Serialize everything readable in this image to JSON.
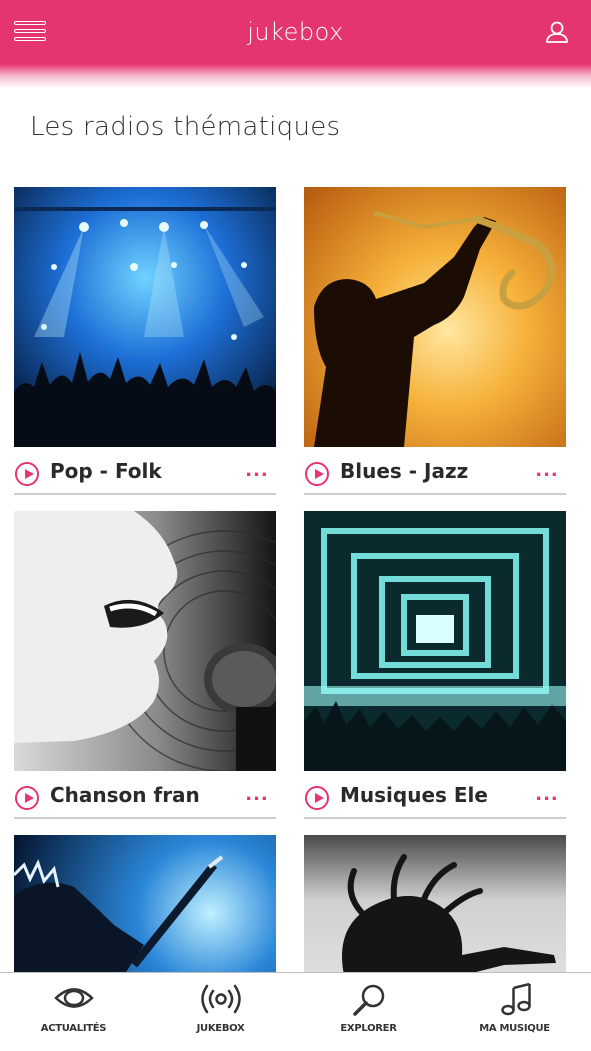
{
  "header": {
    "title": "jukebox",
    "menu_icon": "hamburger-menu-icon",
    "user_icon": "user-icon"
  },
  "section": {
    "title": "Les radios thématiques"
  },
  "cards": [
    {
      "title": "Pop - Folk",
      "more": "...",
      "image": "concert-crowd-stage-lights"
    },
    {
      "title": "Blues - Jazz",
      "more": "...",
      "image": "saxophone-player-silhouette"
    },
    {
      "title": "Chanson fran",
      "more": "...",
      "image": "singer-with-microphone"
    },
    {
      "title": "Musiques Ele",
      "more": "...",
      "image": "electronic-stage-crowd"
    },
    {
      "title": "",
      "more": "",
      "image": "guitarist-blue-stage"
    },
    {
      "title": "",
      "more": "",
      "image": "dreadlocks-singer-silhouette"
    }
  ],
  "bottom_nav": [
    {
      "label": "ACTUALITÉS",
      "icon": "eye-icon"
    },
    {
      "label": "JUKEBOX",
      "icon": "radio-broadcast-icon"
    },
    {
      "label": "EXPLORER",
      "icon": "magnifier-icon"
    },
    {
      "label": "MA MUSIQUE",
      "icon": "music-note-icon"
    }
  ],
  "colors": {
    "accent": "#e4356f",
    "text_dark": "#2a2a2a",
    "divider": "#cfcfcf"
  }
}
